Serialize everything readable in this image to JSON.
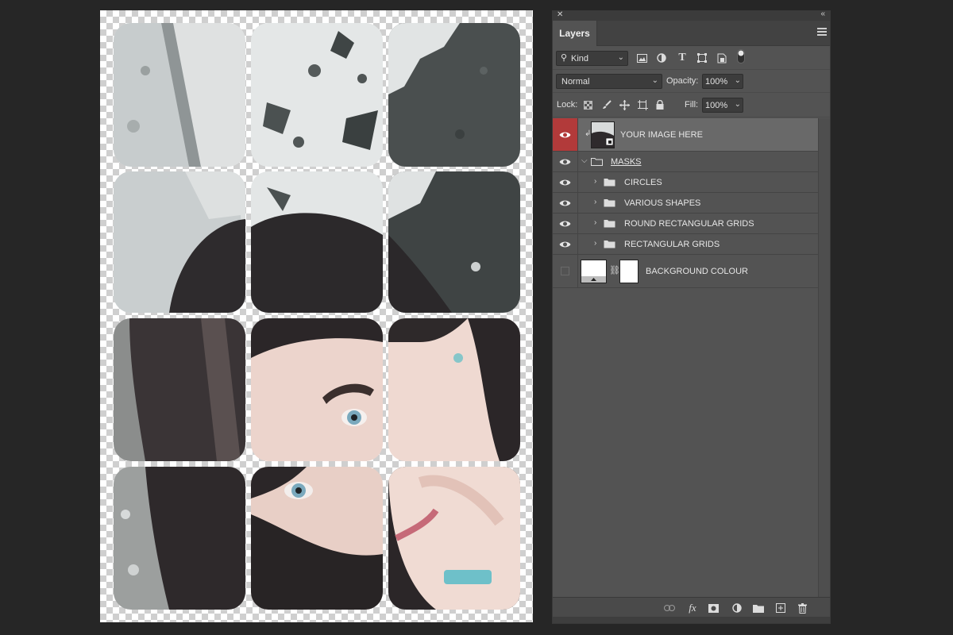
{
  "canvas": {
    "tile_count": 12
  },
  "panel": {
    "tab_label": "Layers",
    "filter": {
      "selected": "Kind"
    },
    "blend_mode": {
      "selected": "Normal"
    },
    "opacity": {
      "label": "Opacity:",
      "value": "100%"
    },
    "lock_label": "Lock:",
    "fill": {
      "label": "Fill:",
      "value": "100%"
    },
    "filter_icons": [
      "image-filter-icon",
      "adjustment-filter-icon",
      "type-filter-icon",
      "shape-filter-icon",
      "smart-object-filter-icon",
      "filter-toggle-icon"
    ],
    "lock_icons": [
      "lock-transparent-icon",
      "lock-image-icon",
      "lock-position-icon",
      "lock-artboard-icon",
      "lock-all-icon"
    ],
    "layers": [
      {
        "name": "YOUR IMAGE HERE",
        "type": "smart-object",
        "visible": true,
        "selected": true
      },
      {
        "name": "MASKS",
        "type": "group-open",
        "visible": true
      },
      {
        "name": "CIRCLES",
        "type": "group",
        "visible": true
      },
      {
        "name": "VARIOUS SHAPES",
        "type": "group",
        "visible": true
      },
      {
        "name": "ROUND RECTANGULAR GRIDS",
        "type": "group",
        "visible": true
      },
      {
        "name": "RECTANGULAR GRIDS",
        "type": "group",
        "visible": true
      },
      {
        "name": "BACKGROUND COLOUR",
        "type": "fill-layer",
        "visible": false
      }
    ],
    "footer_icons": [
      "link-layers-icon",
      "fx-icon",
      "add-mask-icon",
      "adjustment-layer-icon",
      "new-group-icon",
      "new-layer-icon",
      "delete-icon"
    ],
    "colors": {
      "selected_eye": "#b23a3a",
      "panel_bg": "#535353",
      "selected_row": "#696969"
    }
  }
}
